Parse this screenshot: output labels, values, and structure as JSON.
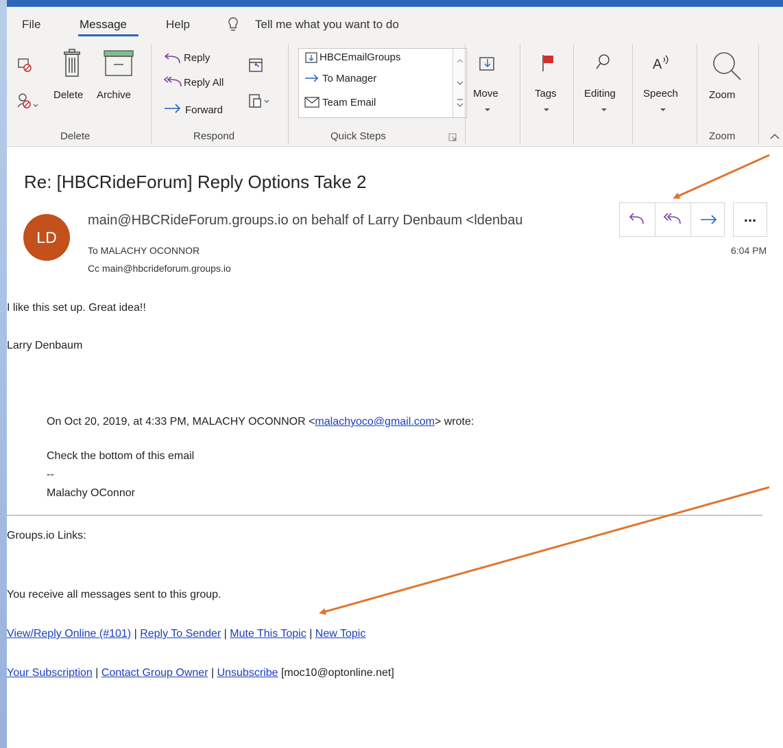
{
  "menu": {
    "file": "File",
    "message": "Message",
    "help": "Help",
    "tell_me": "Tell me what you want to do"
  },
  "ribbon": {
    "delete_group": {
      "delete": "Delete",
      "archive": "Archive",
      "label": "Delete"
    },
    "respond_group": {
      "reply": "Reply",
      "reply_all": "Reply All",
      "forward": "Forward",
      "label": "Respond"
    },
    "quick_steps": {
      "items": [
        "HBCEmailGroups",
        "To Manager",
        "Team Email"
      ],
      "label": "Quick Steps"
    },
    "move": "Move",
    "tags": "Tags",
    "editing": "Editing",
    "speech": "Speech",
    "zoom": {
      "button": "Zoom",
      "label": "Zoom"
    }
  },
  "email": {
    "subject": "Re: [HBCRideForum] Reply Options Take 2",
    "avatar_initials": "LD",
    "sender": "main@HBCRideForum.groups.io on behalf of Larry Denbaum <ldenbau",
    "to": "To  MALACHY OCONNOR",
    "cc": "Cc  main@hbcrideforum.groups.io",
    "time": "6:04 PM",
    "more": "...",
    "body": {
      "line1": "I like this set up.   Great idea!!",
      "signature": "Larry Denbaum",
      "quote_prefix": "On Oct 20, 2019, at 4:33 PM, MALACHY OCONNOR <",
      "quote_email": "malachyoco@gmail.com",
      "quote_suffix": "> wrote:",
      "quote_body": "Check the bottom of this email",
      "quote_dash": "--",
      "quote_sig": "Malachy OConnor"
    },
    "footer": {
      "heading": "Groups.io Links:",
      "notice": "You receive all messages sent to this group.",
      "links1": [
        "View/Reply Online (#101)",
        "Reply To Sender",
        "Mute This Topic",
        "New Topic"
      ],
      "links2": [
        "Your Subscription",
        "Contact Group Owner",
        "Unsubscribe"
      ],
      "separator": "|",
      "address": "[moc10@optonline.net]"
    }
  },
  "colors": {
    "accent": "#2b68b8",
    "avatar": "#c4501b",
    "annotation_arrow": "#e07530",
    "link": "#1a3ebf"
  }
}
